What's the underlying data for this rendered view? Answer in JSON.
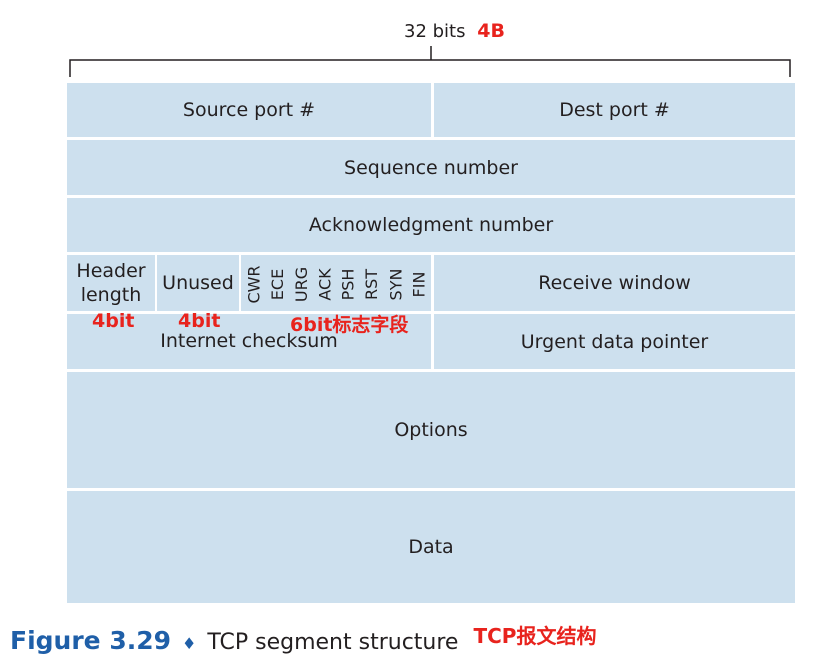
{
  "width_label": "32 bits",
  "width_note": "4B",
  "fields": {
    "source_port": "Source port #",
    "dest_port": "Dest port #",
    "sequence": "Sequence number",
    "ack": "Acknowledgment number",
    "header_length_line1": "Header",
    "header_length_line2": "length",
    "unused": "Unused",
    "flags": [
      "CWR",
      "ECE",
      "URG",
      "ACK",
      "PSH",
      "RST",
      "SYN",
      "FIN"
    ],
    "receive_window": "Receive window",
    "checksum": "Internet checksum",
    "urgent": "Urgent data pointer",
    "options": "Options",
    "data": "Data"
  },
  "annotations": {
    "header_bits": "4bit",
    "unused_bits": "4bit",
    "flags_bits": "6bit标志字段",
    "caption_note": "TCP报文结构"
  },
  "caption": {
    "label": "Figure 3.29",
    "diamond": "♦",
    "text": "TCP segment structure"
  },
  "colors": {
    "cell": "#cde0ee",
    "annotation": "#e8231d",
    "caption_label": "#1f5fa8"
  }
}
